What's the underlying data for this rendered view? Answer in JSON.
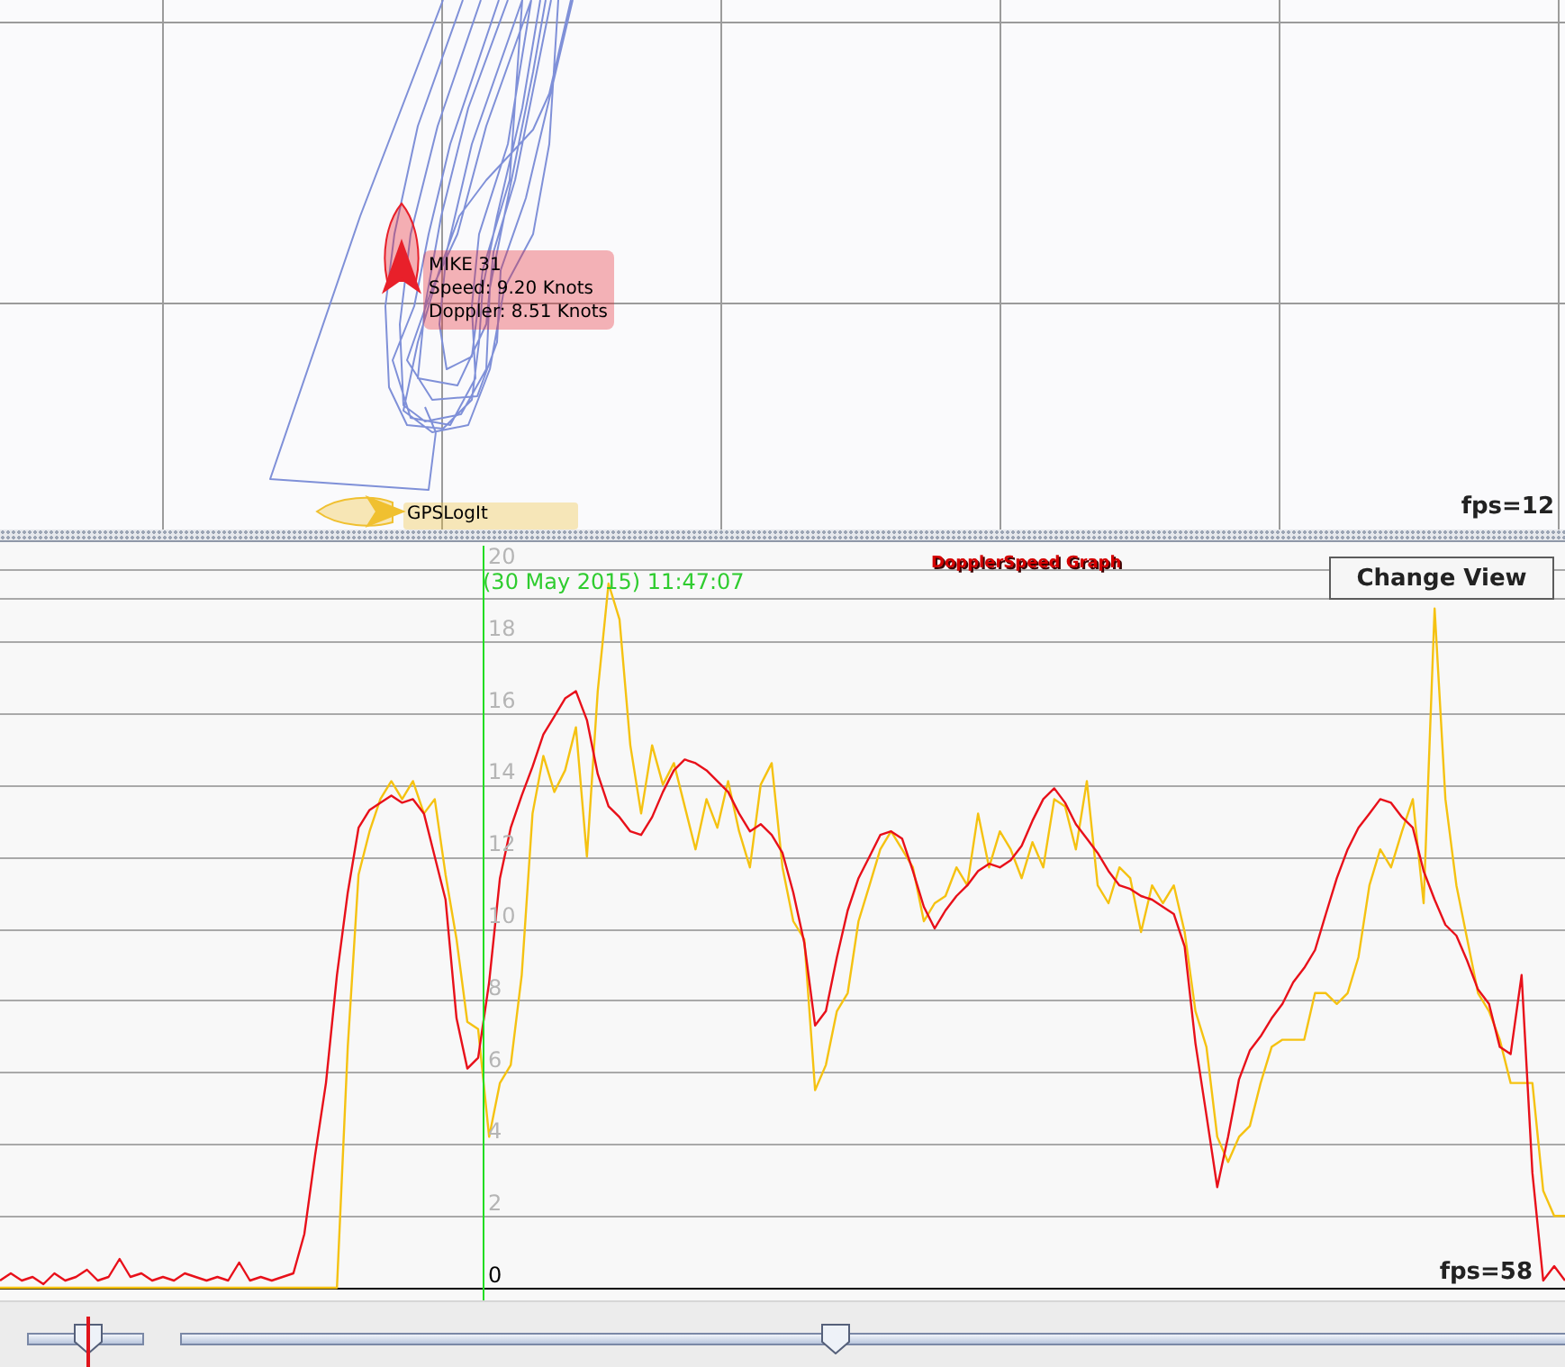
{
  "map": {
    "boats": [
      {
        "name": "MIKE 31",
        "details": [
          "Speed: 9.20 Knots",
          "Doppler: 8.51 Knots"
        ],
        "color": "#e8202a"
      },
      {
        "name": "GPSLogIt",
        "color": "#f0c030"
      }
    ],
    "fps": "fps=12"
  },
  "graph": {
    "cursor_time": "(30 May 2015) 11:47:07",
    "button": "Change View",
    "fps": "fps=58",
    "chart_data": {
      "type": "line",
      "title": "DopplerSpeed Graph",
      "grid": true,
      "ylim": [
        0,
        20
      ],
      "yticks": [
        0,
        2,
        4,
        6,
        8,
        10,
        12,
        14,
        16,
        18,
        20
      ],
      "series": [
        {
          "color": "#e8101a",
          "values": [
            0.2,
            0.4,
            0.2,
            0.3,
            0.1,
            0.4,
            0.2,
            0.3,
            0.5,
            0.2,
            0.3,
            0.8,
            0.3,
            0.4,
            0.2,
            0.3,
            0.2,
            0.4,
            0.3,
            0.2,
            0.3,
            0.2,
            0.7,
            0.2,
            0.3,
            0.2,
            0.3,
            0.4,
            1.5,
            3.7,
            5.7,
            8.7,
            11.0,
            12.8,
            13.3,
            13.5,
            13.7,
            13.5,
            13.6,
            13.2,
            12.0,
            10.8,
            7.5,
            6.1,
            6.4,
            8.5,
            11.4,
            12.8,
            13.7,
            14.5,
            15.4,
            15.9,
            16.4,
            16.6,
            15.8,
            14.3,
            13.4,
            13.1,
            12.7,
            12.6,
            13.1,
            13.8,
            14.4,
            14.7,
            14.6,
            14.4,
            14.1,
            13.8,
            13.2,
            12.7,
            12.9,
            12.6,
            12.1,
            11.0,
            9.6,
            7.3,
            7.7,
            9.2,
            10.5,
            11.4,
            12.0,
            12.6,
            12.7,
            12.5,
            11.6,
            10.6,
            10.0,
            10.5,
            10.9,
            11.2,
            11.6,
            11.8,
            11.7,
            11.9,
            12.3,
            13.0,
            13.6,
            13.9,
            13.5,
            12.9,
            12.5,
            12.1,
            11.6,
            11.2,
            11.1,
            10.9,
            10.8,
            10.6,
            10.4,
            9.5,
            6.8,
            4.8,
            2.8,
            4.2,
            5.8,
            6.6,
            7.0,
            7.5,
            7.9,
            8.5,
            8.9,
            9.4,
            10.4,
            11.4,
            12.2,
            12.8,
            13.2,
            13.6,
            13.5,
            13.1,
            12.8,
            11.6,
            10.8,
            10.1,
            9.8,
            9.1,
            8.3,
            7.9,
            6.7,
            6.5,
            8.7,
            3.2,
            0.2,
            0.6,
            0.2
          ]
        },
        {
          "color": "#f5c211",
          "values": [
            0,
            0,
            0,
            0,
            0,
            0,
            0,
            0,
            0,
            0,
            0,
            0,
            0,
            0,
            0,
            0,
            0,
            0,
            0,
            0,
            0,
            0,
            0,
            0,
            0,
            0,
            0,
            0,
            0,
            0,
            0,
            0,
            6.7,
            11.5,
            12.7,
            13.6,
            14.1,
            13.6,
            14.1,
            13.2,
            13.6,
            11.5,
            9.7,
            7.4,
            7.2,
            4.2,
            5.7,
            6.2,
            8.7,
            13.2,
            14.8,
            13.8,
            14.4,
            15.6,
            12.0,
            16.6,
            19.6,
            18.6,
            15.1,
            13.2,
            15.1,
            14.0,
            14.6,
            13.4,
            12.2,
            13.6,
            12.8,
            14.1,
            12.7,
            11.7,
            14.0,
            14.6,
            11.7,
            10.2,
            9.7,
            5.5,
            6.2,
            7.7,
            8.2,
            10.2,
            11.2,
            12.2,
            12.7,
            12.2,
            11.7,
            10.2,
            10.7,
            10.9,
            11.7,
            11.2,
            13.2,
            11.7,
            12.7,
            12.2,
            11.4,
            12.4,
            11.7,
            13.6,
            13.4,
            12.2,
            14.1,
            11.2,
            10.7,
            11.7,
            11.4,
            9.9,
            11.2,
            10.7,
            11.2,
            9.9,
            7.7,
            6.7,
            4.2,
            3.5,
            4.2,
            4.5,
            5.7,
            6.7,
            6.9,
            6.9,
            6.9,
            8.2,
            8.2,
            7.9,
            8.2,
            9.2,
            11.2,
            12.2,
            11.7,
            12.7,
            13.6,
            10.7,
            18.9,
            13.6,
            11.2,
            9.7,
            8.2,
            7.7,
            6.9,
            5.7,
            5.7,
            5.7,
            2.7,
            2.0,
            2.0
          ]
        }
      ]
    }
  },
  "controls": {
    "small_slider": {
      "level": 0.52
    },
    "wide_slider": {
      "level": 0.47
    }
  }
}
